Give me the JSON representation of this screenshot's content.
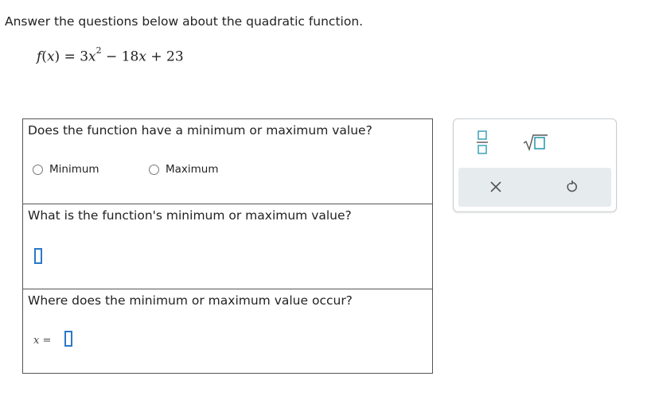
{
  "intro_text": "Answer the questions below about the quadratic function.",
  "formula": {
    "fname": "f",
    "var": "x",
    "coef_a": "3",
    "exp": "2",
    "coef_b": "18",
    "const": "23"
  },
  "question1": {
    "text": "Does the function have a minimum or maximum value?",
    "options": [
      {
        "label": "Minimum",
        "selected": false
      },
      {
        "label": "Maximum",
        "selected": false
      }
    ]
  },
  "question2": {
    "text": "What is the function's minimum or maximum value?",
    "answer": ""
  },
  "question3": {
    "text": "Where does the minimum or maximum value occur?",
    "var": "x",
    "eq": "=",
    "answer": ""
  },
  "toolbar": {
    "icons": [
      "fraction-icon",
      "square-root-icon",
      "clear-icon",
      "undo-icon"
    ]
  },
  "colors": {
    "accent": "#2b78c8",
    "icon_teal": "#2e9bb2",
    "icon_gray": "#555555",
    "toolbar_bg": "#e6ebee"
  }
}
